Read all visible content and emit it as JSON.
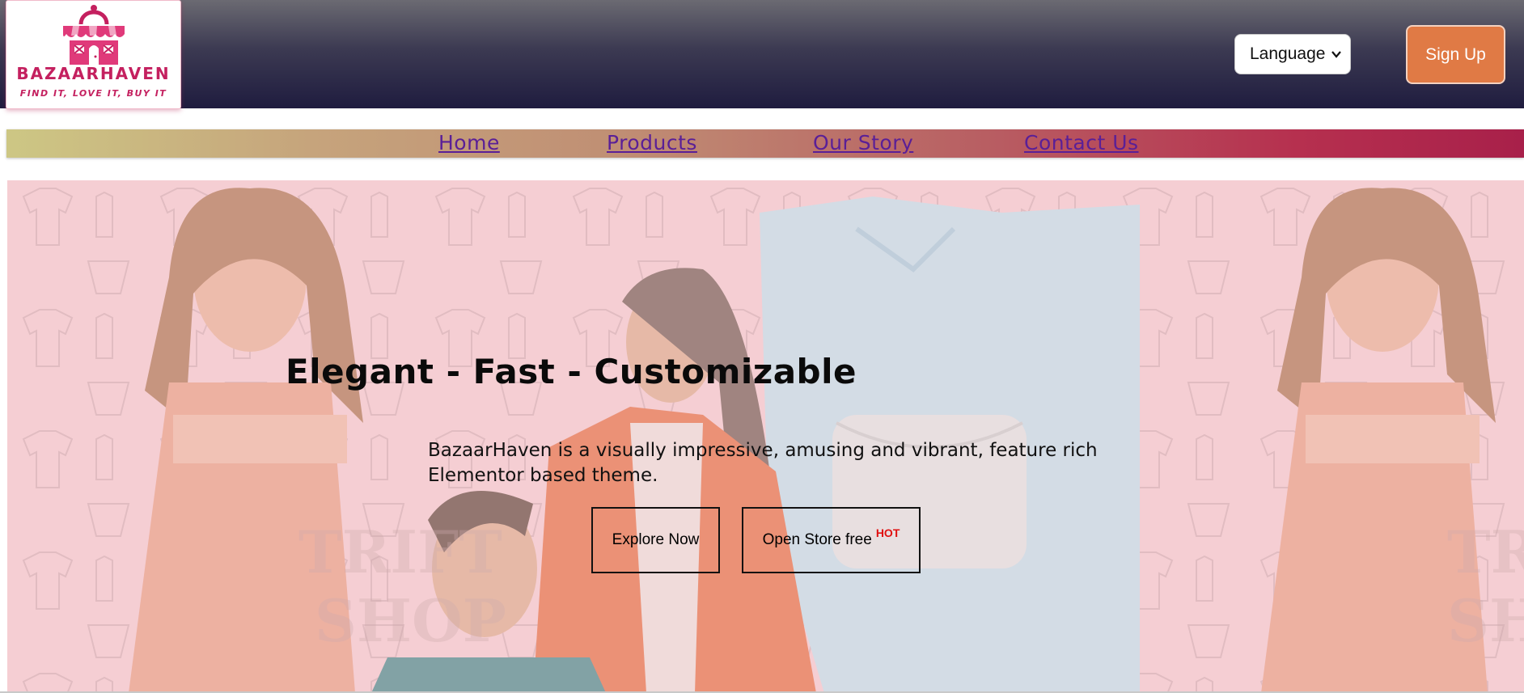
{
  "header": {
    "logo": {
      "name": "BAZAARHAVEN",
      "tagline": "FIND IT, LOVE IT, BUY IT",
      "icon": "shopping-bag-store-icon"
    },
    "language_select": {
      "selected": "Language"
    },
    "signup_label": "Sign Up"
  },
  "nav": {
    "links": [
      {
        "label": "Home"
      },
      {
        "label": "Products"
      },
      {
        "label": "Our Story"
      },
      {
        "label": "Contact Us"
      }
    ]
  },
  "hero": {
    "title": "Elegant - Fast - Customizable",
    "description": "BazaarHaven is a visually impressive, amusing and vibrant, feature rich Elementor based theme.",
    "buttons": {
      "explore_label": "Explore Now",
      "open_store_label": "Open Store free",
      "open_store_badge": "HOT"
    },
    "background_watermark": [
      "TRIFT",
      "SHOP"
    ]
  },
  "colors": {
    "brand_pink": "#c4205f",
    "signup_orange": "#e07a45",
    "nav_link_purple": "#5a1f97",
    "hot_badge_red": "#e01010",
    "hero_bg_pink": "#f2c6cc"
  }
}
